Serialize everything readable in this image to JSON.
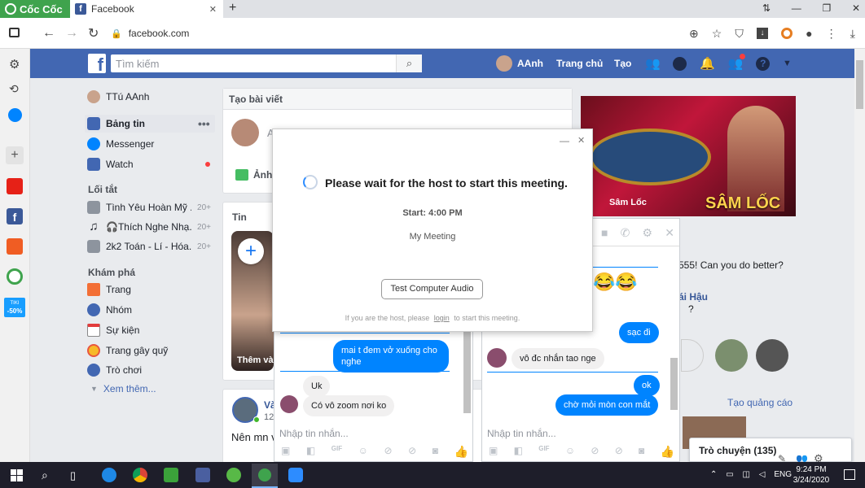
{
  "browser": {
    "brand": "Cốc Cốc",
    "tab_title": "Facebook",
    "url": "facebook.com",
    "new_tab_symbol": "+",
    "close_symbol": "✕"
  },
  "rail": {
    "discount": "-50%",
    "discount_top": "TIKI"
  },
  "facebook": {
    "search_placeholder": "Tìm kiếm",
    "profile_name": "AAnh",
    "nav_home": "Trang chủ",
    "nav_create": "Tạo"
  },
  "left_nav": {
    "user": "TTú AAnh",
    "news_feed": "Bảng tin",
    "messenger": "Messenger",
    "watch": "Watch",
    "shortcuts_title": "Lối tắt",
    "shortcuts": [
      {
        "label": "Tình Yêu Hoàn Mỹ ...",
        "count": "20+"
      },
      {
        "label": "🎧Thích Nghe Nhạ...",
        "count": "20+"
      },
      {
        "label": "2k2 Toán - Lí - Hóa...",
        "count": "20+"
      }
    ],
    "explore_title": "Khám phá",
    "explore": [
      "Trang",
      "Nhóm",
      "Sự kiện",
      "Trang gây quỹ",
      "Trò chơi"
    ],
    "see_more": "Xem thêm..."
  },
  "composer": {
    "title": "Tạo bài viết",
    "placeholder": "Anh ơi, bạn đang nghĩ gì?",
    "photo_label": "Ảnh"
  },
  "stories": {
    "title": "Tin",
    "add_label": "Thêm và"
  },
  "post": {
    "author_short": "Và",
    "time_short": "12",
    "text_short": "Nên mn vả"
  },
  "ad": {
    "game_caption": "Sâm Lốc",
    "game_title": "SÂM LỐC",
    "challenge_text": "555! Can you do better?",
    "name_text": "ái Hậu",
    "question_text": "?",
    "sponsored": "Tạo quảng cáo"
  },
  "modal": {
    "status": "Please wait for the host to start this meeting.",
    "start_label": "Start: 4:00 PM",
    "meeting_name": "My Meeting",
    "test_audio": "Test Computer Audio",
    "footer_prefix": "If you are the host, please",
    "footer_link": "login",
    "footer_suffix": "to start this meeting."
  },
  "chat1": {
    "messages": [
      {
        "text": "mai t đem vở xuống cho nghe",
        "from": "me"
      },
      {
        "text": "Uk",
        "from": "them"
      },
      {
        "text": "Có vô zoom nơi ko",
        "from": "them"
      }
    ],
    "input_placeholder": "Nhập tin nhắn..."
  },
  "chat2": {
    "messages": [
      {
        "text": "sạc đi",
        "from": "me"
      },
      {
        "text": "vô đc nhắn tao nge",
        "from": "them"
      },
      {
        "text": "ok",
        "from": "me"
      },
      {
        "text": "chờ mỏi mòn con mắt",
        "from": "me"
      }
    ],
    "emoji": "😂😂",
    "input_placeholder": "Nhập tin nhắn..."
  },
  "chat_dock": {
    "label": "Trò chuyện (135)"
  },
  "taskbar": {
    "time": "9:24 PM",
    "date": "3/24/2020",
    "lang": "ENG"
  },
  "colors": {
    "fb_blue": "#4267b2",
    "messenger_blue": "#0084ff",
    "coccoc_green": "#3fa34d"
  }
}
